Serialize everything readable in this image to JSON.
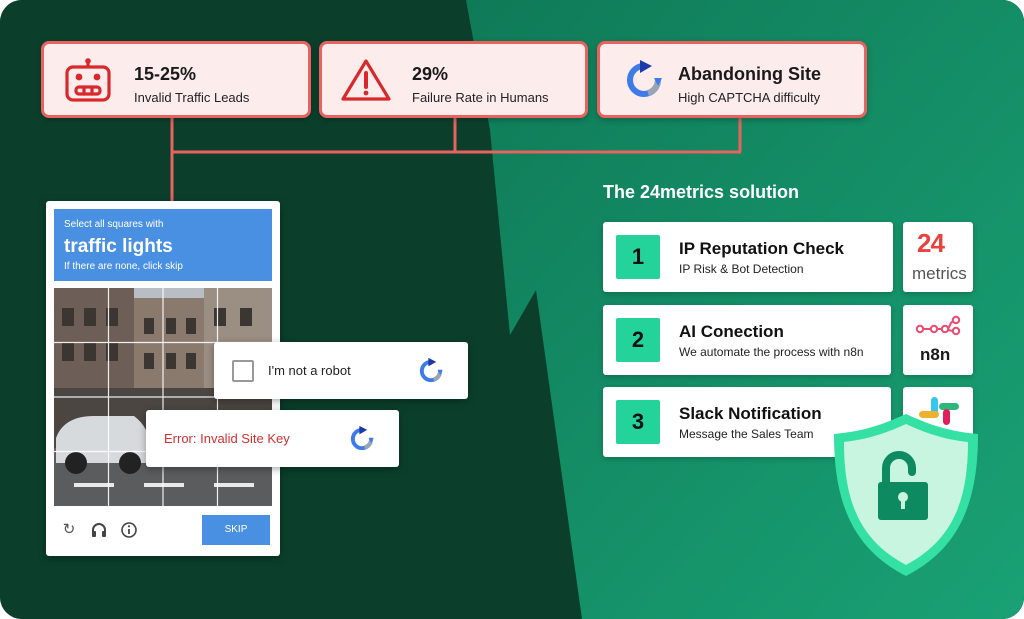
{
  "problems": [
    {
      "value": "15-25%",
      "label": "Invalid Traffic Leads",
      "icon": "robot-icon"
    },
    {
      "value": "29%",
      "label": "Failure Rate in Humans",
      "icon": "warning-icon"
    },
    {
      "value": "Abandoning Site",
      "label": "High CAPTCHA difficulty",
      "icon": "recaptcha-icon"
    }
  ],
  "captcha": {
    "instruction": "Select all squares with",
    "target": "traffic lights",
    "hint": "If there are none, click skip",
    "skip_label": "SKIP"
  },
  "robot_check": {
    "label": "I'm not a robot"
  },
  "error": {
    "label": "Error: Invalid Site Key"
  },
  "solution": {
    "title": "The 24metrics solution",
    "steps": [
      {
        "number": "1",
        "title": "IP Reputation Check",
        "subtitle": "IP Risk & Bot Detection",
        "logo": "24metrics-logo"
      },
      {
        "number": "2",
        "title": "AI Conection",
        "subtitle": "We automate the process with n8n",
        "logo": "n8n-logo"
      },
      {
        "number": "3",
        "title": "Slack Notification",
        "subtitle": "Message the Sales Team",
        "logo": "slack-logo"
      }
    ],
    "logo_24_top": "24",
    "logo_24_bottom": "metrics",
    "logo_n8n": "n8n"
  },
  "colors": {
    "dark_green": "#0b3f2c",
    "mid_green": "#128a63",
    "coral": "#e8625f",
    "card_pink": "#fdecec",
    "accent_green": "#24d39a",
    "captcha_blue": "#4a90e2"
  },
  "shield_icon": "unlocked-padlock-shield-icon"
}
